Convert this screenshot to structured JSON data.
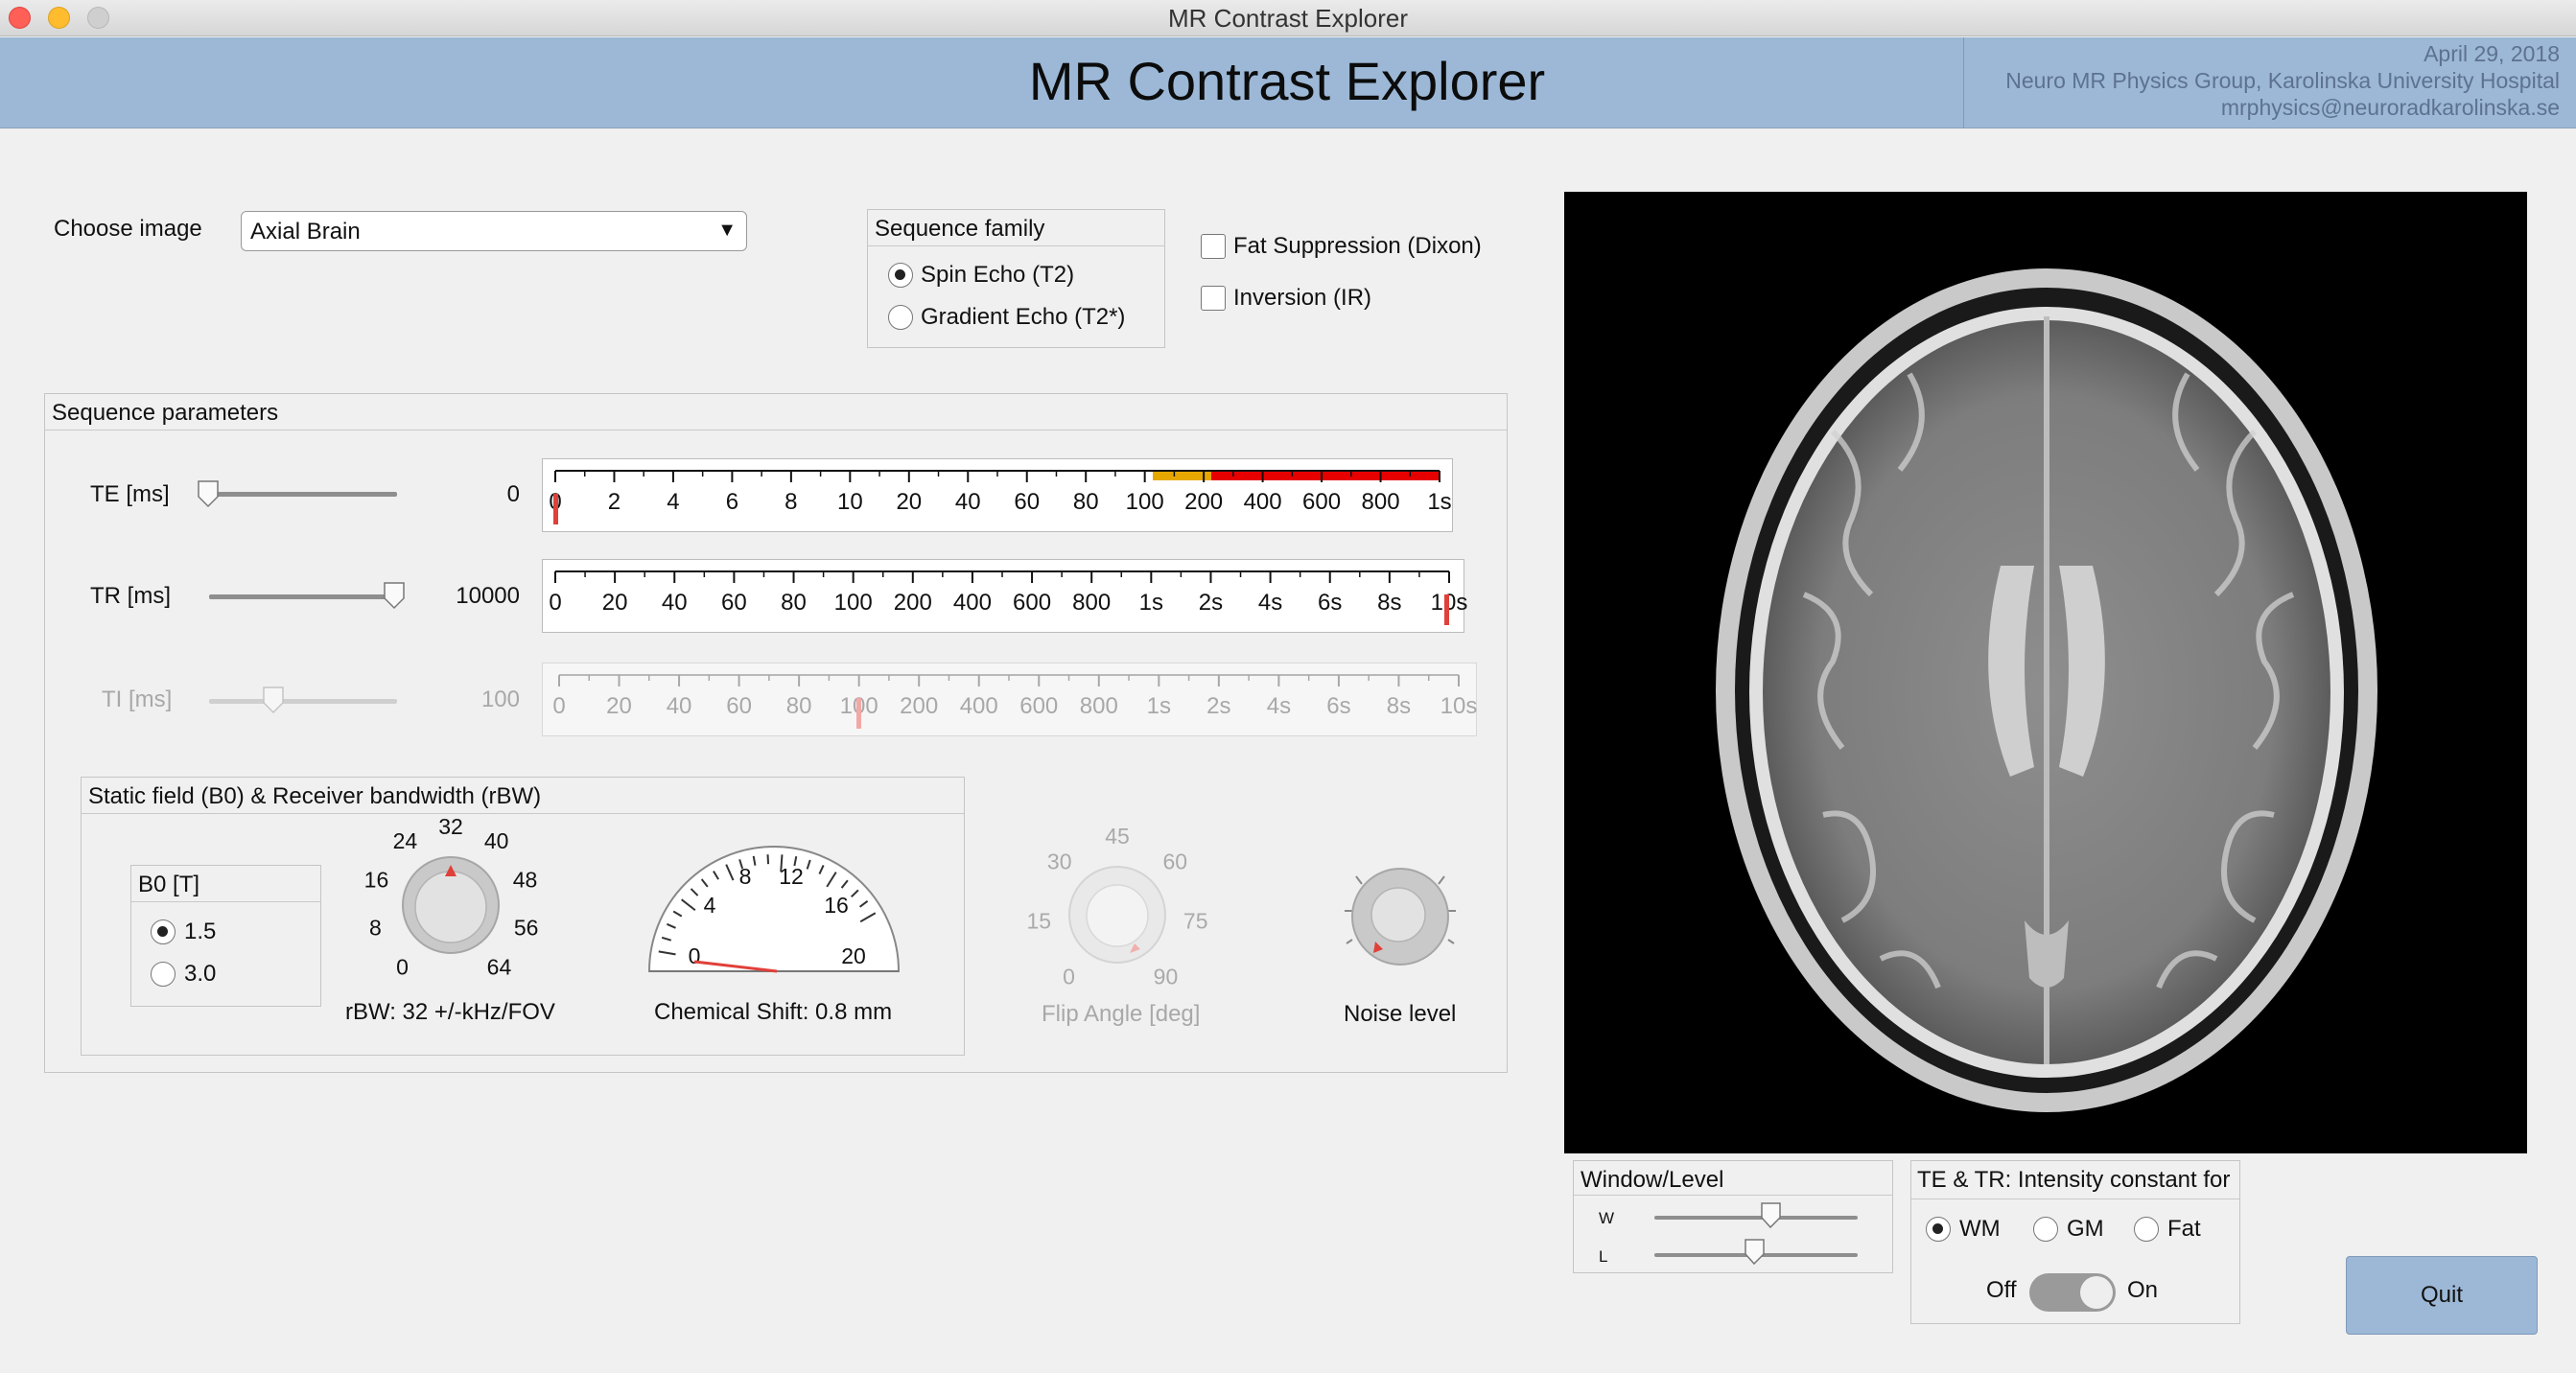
{
  "window": {
    "title": "MR Contrast Explorer"
  },
  "header": {
    "title": "MR Contrast Explorer",
    "date": "April 29, 2018",
    "group": "Neuro MR Physics Group, Karolinska University Hospital",
    "email": "mrphysics@neuroradkarolinska.se"
  },
  "image_select": {
    "label": "Choose image",
    "value": "Axial Brain"
  },
  "sequence_family": {
    "title": "Sequence family",
    "options": [
      "Spin Echo (T2)",
      "Gradient Echo (T2*)"
    ],
    "selected": "Spin Echo (T2)"
  },
  "options": {
    "fat_suppression": "Fat Suppression (Dixon)",
    "fat_suppression_checked": false,
    "inversion": "Inversion (IR)",
    "inversion_checked": false
  },
  "sequence_parameters": {
    "title": "Sequence parameters",
    "te": {
      "label": "TE [ms]",
      "value": "0",
      "ticks": [
        "0",
        "2",
        "4",
        "6",
        "8",
        "10",
        "20",
        "40",
        "60",
        "80",
        "100",
        "200",
        "400",
        "600",
        "800",
        "1s"
      ]
    },
    "tr": {
      "label": "TR [ms]",
      "value": "10000",
      "ticks": [
        "0",
        "20",
        "40",
        "60",
        "80",
        "100",
        "200",
        "400",
        "600",
        "800",
        "1s",
        "2s",
        "4s",
        "6s",
        "8s",
        "10s"
      ]
    },
    "ti": {
      "label": "TI [ms]",
      "value": "100",
      "ticks": [
        "0",
        "20",
        "40",
        "60",
        "80",
        "100",
        "200",
        "400",
        "600",
        "800",
        "1s",
        "2s",
        "4s",
        "6s",
        "8s",
        "10s"
      ]
    }
  },
  "static_field": {
    "title": "Static field (B0) & Receiver bandwidth (rBW)",
    "b0": {
      "title": "B0 [T]",
      "options": [
        "1.5",
        "3.0"
      ],
      "selected": "1.5"
    },
    "rbw": {
      "ticks": [
        "0",
        "8",
        "16",
        "24",
        "32",
        "40",
        "48",
        "56",
        "64"
      ],
      "label": "rBW: 32 +/-kHz/FOV",
      "value": 32
    },
    "chemical_shift": {
      "ticks": [
        "0",
        "4",
        "8",
        "12",
        "16",
        "20"
      ],
      "label": "Chemical Shift: 0.8 mm",
      "value": 0.8
    }
  },
  "flip_angle": {
    "ticks": [
      "0",
      "15",
      "30",
      "45",
      "60",
      "75",
      "90"
    ],
    "label": "Flip Angle [deg]",
    "value": 90
  },
  "noise": {
    "label": "Noise level"
  },
  "window_level": {
    "title": "Window/Level",
    "w_label": "W",
    "l_label": "L",
    "w_value": 0.58,
    "l_value": 0.49
  },
  "intensity": {
    "title": "TE & TR: Intensity constant for",
    "options": [
      "WM",
      "GM",
      "Fat"
    ],
    "selected": "WM",
    "off": "Off",
    "on": "On",
    "state": "On"
  },
  "quit": {
    "label": "Quit"
  },
  "colors": {
    "banner": "#9cb8d6",
    "marker": "#e0403a",
    "danger": "#e60000",
    "warn": "#e6a800"
  }
}
